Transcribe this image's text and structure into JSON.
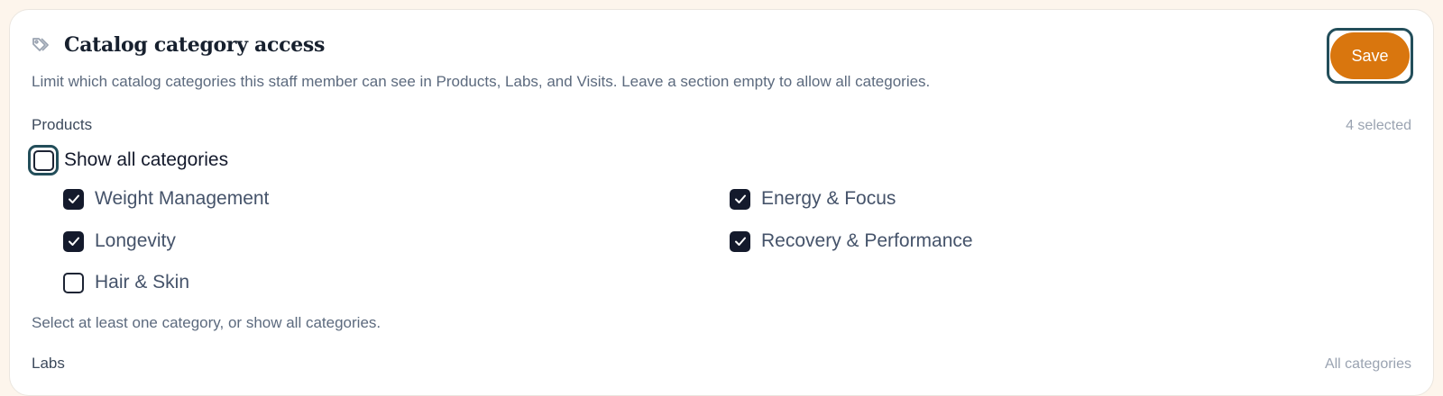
{
  "card": {
    "title": "Catalog category access",
    "description": "Limit which catalog categories this staff member can see in Products, Labs, and Visits. Leave a section empty to allow all categories.",
    "save_label": "Save"
  },
  "products": {
    "label": "Products",
    "count": "4 selected",
    "show_all_label": "Show all categories",
    "show_all_checked": false,
    "categories": [
      {
        "label": "Weight Management",
        "checked": true
      },
      {
        "label": "Energy & Focus",
        "checked": true
      },
      {
        "label": "Longevity",
        "checked": true
      },
      {
        "label": "Recovery & Performance",
        "checked": true
      },
      {
        "label": "Hair & Skin",
        "checked": false
      }
    ],
    "hint": "Select at least one category, or show all categories."
  },
  "labs": {
    "label": "Labs",
    "count": "All categories"
  },
  "colors": {
    "accent": "#d9760e",
    "focus": "#234e5a",
    "checkbox_checked": "#141a2c"
  },
  "icons": {
    "header": "tag-icon",
    "check": "check-icon"
  }
}
